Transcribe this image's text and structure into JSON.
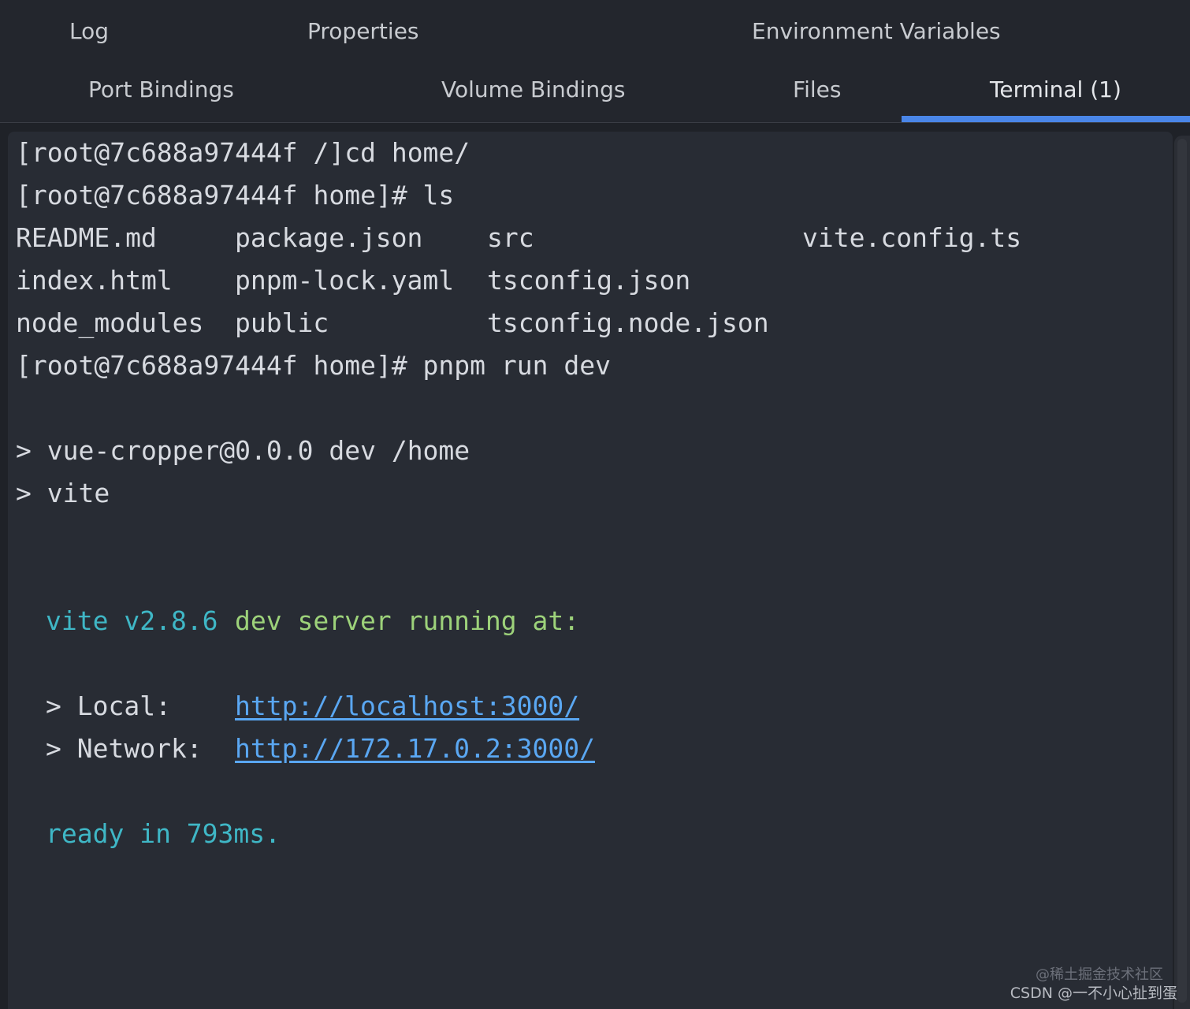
{
  "tabs": [
    {
      "label": "Log"
    },
    {
      "label": "Properties"
    },
    {
      "label": "Environment Variables"
    },
    {
      "label": "Port Bindings"
    },
    {
      "label": "Volume Bindings"
    },
    {
      "label": "Files"
    },
    {
      "label": "Terminal (1)",
      "active": true
    }
  ],
  "terminal": {
    "cmd1": "[root@7c688a97444f /]cd home/",
    "cmd2": "[root@7c688a97444f home]# ls",
    "ls_rows": [
      [
        "README.md",
        "package.json",
        "src",
        "vite.config.ts"
      ],
      [
        "index.html",
        "pnpm-lock.yaml",
        "tsconfig.json",
        ""
      ],
      [
        "node_modules",
        "public",
        "tsconfig.node.json",
        ""
      ]
    ],
    "cmd3": "[root@7c688a97444f home]# pnpm run dev",
    "script_line1": "> vue-cropper@0.0.0 dev /home",
    "script_line2": "> vite",
    "vite_version": "vite v2.8.6",
    "server_running": "dev server running at:",
    "local_label": "> Local:",
    "local_url": "http://localhost:3000/",
    "network_label": "> Network:",
    "network_url": "http://172.17.0.2:3000/",
    "ready": "ready in 793ms."
  },
  "watermark": {
    "line1": "@稀土掘金技术社区",
    "line2": "CSDN @一不小心扯到蛋"
  },
  "colors": {
    "accent": "#4a86e8",
    "cyan": "#3fb7c6",
    "green": "#9dd27a",
    "link": "#5aa7f2"
  }
}
